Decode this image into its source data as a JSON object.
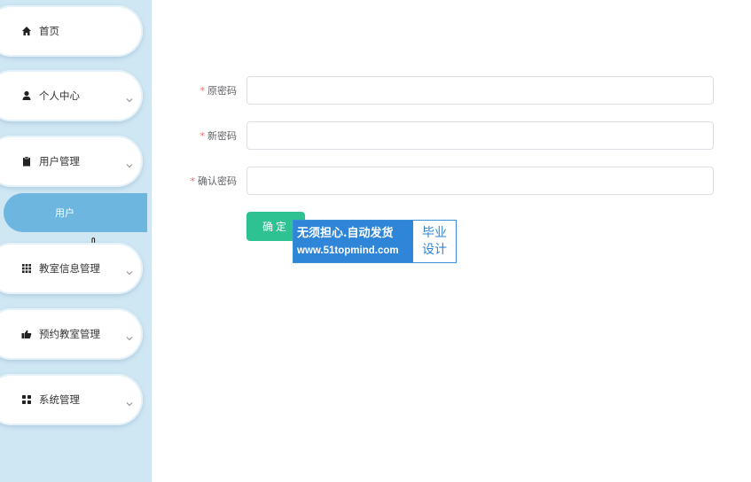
{
  "sidebar": {
    "items": [
      {
        "label": "首页",
        "icon": "home-icon",
        "has_chevron": false
      },
      {
        "label": "个人中心",
        "icon": "user-icon",
        "has_chevron": true
      },
      {
        "label": "用户管理",
        "icon": "clipboard-icon",
        "has_chevron": true
      },
      {
        "label": "教室信息管理",
        "icon": "grid-icon",
        "has_chevron": true
      },
      {
        "label": "预约教室管理",
        "icon": "hand-icon",
        "has_chevron": true
      },
      {
        "label": "系统管理",
        "icon": "apps-icon",
        "has_chevron": true
      }
    ],
    "active_submenu": {
      "label": "用户"
    }
  },
  "form": {
    "old_password": {
      "label": "原密码",
      "value": "",
      "required": true
    },
    "new_password": {
      "label": "新密码",
      "value": "",
      "required": true
    },
    "confirm_password": {
      "label": "确认密码",
      "value": "",
      "required": true
    },
    "submit_label": "确定"
  },
  "watermark": {
    "line1": "无须担心.自动发货",
    "line2": "www.51topmind.com",
    "right1": "毕业",
    "right2": "设计"
  },
  "colors": {
    "sidebar_bg": "#cfe6f3",
    "active_bg": "#6cb6df",
    "primary": "#2ec192",
    "required": "#f56c6c"
  }
}
